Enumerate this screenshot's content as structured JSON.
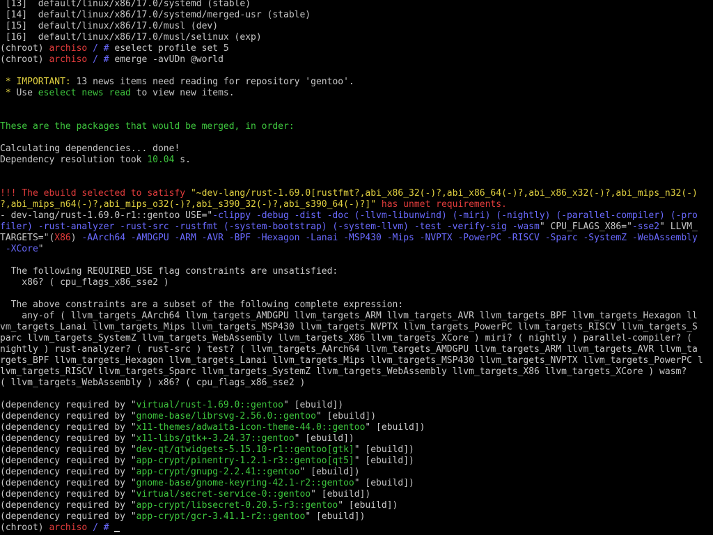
{
  "colors": {
    "background": "#000000",
    "text": "#c8c8c8",
    "green": "#3ec63e",
    "red": "#e23c3c",
    "yellow": "#e0d040",
    "blue": "#6a6aff"
  },
  "prompt": {
    "open": "(chroot)",
    "host": "archiso",
    "path": "/",
    "symbol": "#"
  },
  "lines": [
    [
      {
        "t": " [13]  default/linux/x86/17.0/systemd (stable)"
      }
    ],
    [
      {
        "t": " [14]  default/linux/x86/17.0/systemd/merged-usr (stable)"
      }
    ],
    [
      {
        "t": " [15]  default/linux/x86/17.0/musl (dev)"
      }
    ],
    [
      {
        "t": " [16]  default/linux/x86/17.0/musl/selinux (exp)"
      }
    ],
    [
      {
        "t": "(chroot) "
      },
      {
        "t": "archiso",
        "c": "red"
      },
      {
        "t": " / ",
        "c": "blue"
      },
      {
        "t": "# ",
        "c": "blue"
      },
      {
        "t": "eselect profile set 5"
      }
    ],
    [
      {
        "t": "(chroot) "
      },
      {
        "t": "archiso",
        "c": "red"
      },
      {
        "t": " / ",
        "c": "blue"
      },
      {
        "t": "# ",
        "c": "blue"
      },
      {
        "t": "emerge -avUDn @world"
      }
    ],
    [
      {
        "t": ""
      }
    ],
    [
      {
        "t": " * ",
        "c": "yellow"
      },
      {
        "t": "IMPORTANT:",
        "c": "yellow"
      },
      {
        "t": " 13 news items need reading for repository 'gentoo'."
      }
    ],
    [
      {
        "t": " * ",
        "c": "yellow"
      },
      {
        "t": "Use "
      },
      {
        "t": "eselect news read",
        "c": "green"
      },
      {
        "t": " to view new items."
      }
    ],
    [
      {
        "t": ""
      }
    ],
    [
      {
        "t": ""
      }
    ],
    [
      {
        "t": "These are the packages that would be merged, in order:",
        "c": "green"
      }
    ],
    [
      {
        "t": ""
      }
    ],
    [
      {
        "t": "Calculating dependencies... done!"
      }
    ],
    [
      {
        "t": "Dependency resolution took "
      },
      {
        "t": "10.04",
        "c": "green"
      },
      {
        "t": " s."
      }
    ],
    [
      {
        "t": ""
      }
    ],
    [
      {
        "t": ""
      }
    ],
    [
      {
        "t": "!!! ",
        "c": "red"
      },
      {
        "t": "The ebuild selected to satisfy ",
        "c": "red"
      },
      {
        "t": "\"~dev-lang/rust-1.69.0[rustfmt?,abi_x86_32(-)?,abi_x86_64(-)?,abi_x86_x32(-)?,abi_mips_n32(-)",
        "c": "yellow"
      }
    ],
    [
      {
        "t": "?,abi_mips_n64(-)?,abi_mips_o32(-)?,abi_s390_32(-)?,abi_s390_64(-)?]\"",
        "c": "yellow"
      },
      {
        "t": " has unmet requirements.",
        "c": "red"
      }
    ],
    [
      {
        "t": "- dev-lang/rust-1.69.0-r1::gentoo USE=\""
      },
      {
        "t": "-clippy -debug -dist -doc (-llvm-libunwind) (-miri) (-nightly) (-parallel-compiler) (-pro",
        "c": "blue"
      }
    ],
    [
      {
        "t": "filer) -rust-analyzer -rust-src -rustfmt (-system-bootstrap) (-system-llvm) -test -verify-sig -wasm",
        "c": "blue"
      },
      {
        "t": "\" CPU_FLAGS_X86=\""
      },
      {
        "t": "-sse2",
        "c": "blue"
      },
      {
        "t": "\" LLVM_"
      }
    ],
    [
      {
        "t": "TARGETS=\"("
      },
      {
        "t": "X86",
        "c": "red"
      },
      {
        "t": ") "
      },
      {
        "t": "-AArch64 -AMDGPU -ARM -AVR -BPF -Hexagon -Lanai -MSP430 -Mips -NVPTX -PowerPC -RISCV -Sparc -SystemZ -WebAssembly",
        "c": "blue"
      }
    ],
    [
      {
        "t": " -XCore",
        "c": "blue"
      },
      {
        "t": "\""
      }
    ],
    [
      {
        "t": ""
      }
    ],
    [
      {
        "t": "  The following REQUIRED_USE flag constraints are unsatisfied:"
      }
    ],
    [
      {
        "t": "    x86? ( cpu_flags_x86_sse2 )"
      }
    ],
    [
      {
        "t": ""
      }
    ],
    [
      {
        "t": "  The above constraints are a subset of the following complete expression:"
      }
    ],
    [
      {
        "t": "    any-of ( llvm_targets_AArch64 llvm_targets_AMDGPU llvm_targets_ARM llvm_targets_AVR llvm_targets_BPF llvm_targets_Hexagon ll"
      }
    ],
    [
      {
        "t": "vm_targets_Lanai llvm_targets_Mips llvm_targets_MSP430 llvm_targets_NVPTX llvm_targets_PowerPC llvm_targets_RISCV llvm_targets_S"
      }
    ],
    [
      {
        "t": "parc llvm_targets_SystemZ llvm_targets_WebAssembly llvm_targets_X86 llvm_targets_XCore ) miri? ( nightly ) parallel-compiler? ("
      }
    ],
    [
      {
        "t": "nightly ) rust-analyzer? ( rust-src ) test? ( llvm_targets_AArch64 llvm_targets_AMDGPU llvm_targets_ARM llvm_targets_AVR llvm_ta"
      }
    ],
    [
      {
        "t": "rgets_BPF llvm_targets_Hexagon llvm_targets_Lanai llvm_targets_Mips llvm_targets_MSP430 llvm_targets_NVPTX llvm_targets_PowerPC l"
      }
    ],
    [
      {
        "t": "lvm_targets_RISCV llvm_targets_Sparc llvm_targets_SystemZ llvm_targets_WebAssembly llvm_targets_X86 llvm_targets_XCore ) wasm?"
      }
    ],
    [
      {
        "t": "( llvm_targets_WebAssembly ) x86? ( cpu_flags_x86_sse2 )"
      }
    ],
    [
      {
        "t": ""
      }
    ],
    [
      {
        "t": "(dependency required by \""
      },
      {
        "t": "virtual/rust-1.69.0::gentoo",
        "c": "green"
      },
      {
        "t": "\" [ebuild])"
      }
    ],
    [
      {
        "t": "(dependency required by \""
      },
      {
        "t": "gnome-base/librsvg-2.56.0::gentoo",
        "c": "green"
      },
      {
        "t": "\" [ebuild])"
      }
    ],
    [
      {
        "t": "(dependency required by \""
      },
      {
        "t": "x11-themes/adwaita-icon-theme-44.0::gentoo",
        "c": "green"
      },
      {
        "t": "\" [ebuild])"
      }
    ],
    [
      {
        "t": "(dependency required by \""
      },
      {
        "t": "x11-libs/gtk+-3.24.37::gentoo",
        "c": "green"
      },
      {
        "t": "\" [ebuild])"
      }
    ],
    [
      {
        "t": "(dependency required by \""
      },
      {
        "t": "dev-qt/qtwidgets-5.15.10-r1::gentoo[gtk]",
        "c": "green"
      },
      {
        "t": "\" [ebuild])"
      }
    ],
    [
      {
        "t": "(dependency required by \""
      },
      {
        "t": "app-crypt/pinentry-1.2.1-r3::gentoo[qt5]",
        "c": "green"
      },
      {
        "t": "\" [ebuild])"
      }
    ],
    [
      {
        "t": "(dependency required by \""
      },
      {
        "t": "app-crypt/gnupg-2.2.41::gentoo",
        "c": "green"
      },
      {
        "t": "\" [ebuild])"
      }
    ],
    [
      {
        "t": "(dependency required by \""
      },
      {
        "t": "gnome-base/gnome-keyring-42.1-r2::gentoo",
        "c": "green"
      },
      {
        "t": "\" [ebuild])"
      }
    ],
    [
      {
        "t": "(dependency required by \""
      },
      {
        "t": "virtual/secret-service-0::gentoo",
        "c": "green"
      },
      {
        "t": "\" [ebuild])"
      }
    ],
    [
      {
        "t": "(dependency required by \""
      },
      {
        "t": "app-crypt/libsecret-0.20.5-r3::gentoo",
        "c": "green"
      },
      {
        "t": "\" [ebuild])"
      }
    ],
    [
      {
        "t": "(dependency required by \""
      },
      {
        "t": "app-crypt/gcr-3.41.1-r2::gentoo",
        "c": "green"
      },
      {
        "t": "\" [ebuild])"
      }
    ]
  ]
}
